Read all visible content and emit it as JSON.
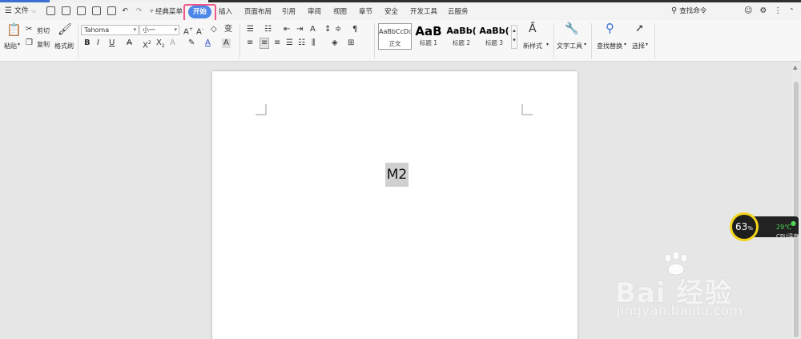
{
  "menubar": {
    "file_label": "文件",
    "tabs": [
      "经典菜单",
      "开始",
      "插入",
      "页面布局",
      "引用",
      "审阅",
      "视图",
      "章节",
      "安全",
      "开发工具",
      "云服务"
    ],
    "active_tab": "开始",
    "search_label": "查找命令"
  },
  "toolbar": {
    "paste_label": "粘贴",
    "cut_label": "剪切",
    "copy_label": "复制",
    "format_painter_label": "格式刷",
    "font_name": "Tahoma",
    "font_size": "小一",
    "styles": [
      {
        "preview": "AaBbCcDd",
        "name": "正文"
      },
      {
        "preview": "AaB",
        "name": "标题 1"
      },
      {
        "preview": "AaBb(",
        "name": "标题 2"
      },
      {
        "preview": "AaBb(",
        "name": "标题 3"
      }
    ],
    "new_style_label": "新样式",
    "text_tools_label": "文字工具",
    "find_replace_label": "查找替换",
    "select_label": "选择"
  },
  "document": {
    "text": "M2"
  },
  "cpu_widget": {
    "percent": "63",
    "percent_unit": "%",
    "temp": "29℃",
    "label": "CPU温度"
  },
  "watermark": {
    "logo_text": "Bai 经验",
    "url": "jingyan.baidu.com"
  },
  "colors": {
    "accent": "#4c86e8",
    "highlight": "#f0568a",
    "cpu_ring": "#f2d41a"
  }
}
